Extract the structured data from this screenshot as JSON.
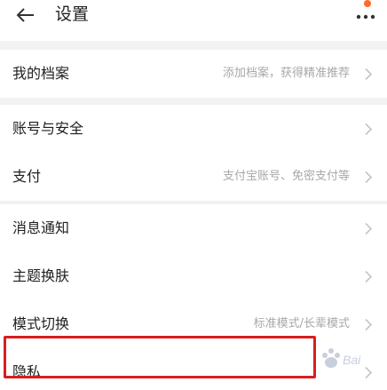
{
  "header": {
    "title": "设置",
    "back_icon": "arrow-left-icon",
    "more_icon": "more-dots-icon",
    "notification_color": "#ff6a2a"
  },
  "groups": [
    {
      "rows": [
        {
          "label": "我的档案",
          "hint": "添加档案，获得精准推荐"
        }
      ]
    },
    {
      "rows": [
        {
          "label": "账号与安全",
          "hint": ""
        },
        {
          "label": "支付",
          "hint": "支付宝账号、免密支付等"
        }
      ]
    },
    {
      "rows": [
        {
          "label": "消息通知",
          "hint": ""
        },
        {
          "label": "主题换肤",
          "hint": ""
        },
        {
          "label": "模式切换",
          "hint": "标准模式/长辈模式"
        },
        {
          "label": "隐私",
          "hint": ""
        }
      ]
    }
  ],
  "annotation": {
    "highlight_color": "#d81e1e",
    "watermark": "Baidu 经验"
  }
}
